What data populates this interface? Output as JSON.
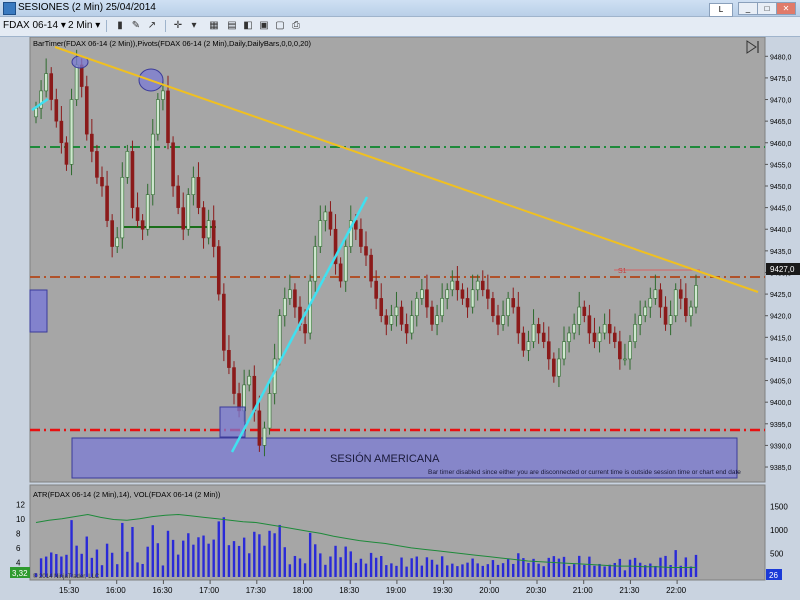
{
  "window": {
    "title": "SESIONES (2 Min)  25/04/2014",
    "layout_button": "L",
    "minimize": "_",
    "maximize": "□",
    "close": "✕"
  },
  "toolbar": {
    "instrument": "FDAX 06-14",
    "interval": "2 Min",
    "dropdown": "▾",
    "icons": [
      "bar-chart-icon",
      "pencil-icon",
      "draw-tool-icon",
      "crosshair-icon",
      "grid-icon",
      "properties-icon",
      "strategies-icon",
      "templates-icon",
      "image-icon",
      "print-icon"
    ]
  },
  "price_panel": {
    "indicator_label": "BarTimer(FDAX 06-14 (2 Min)),Pivots(FDAX 06-14 (2 Min),Daily,DailyBars,0,0,0,20)",
    "current_price": "9427,0",
    "pivot_label": "S1",
    "session_label": "SESIÓN AMERICANA",
    "bar_timer_notice": "Bar timer disabled since either you are disconnected or current time is outside session time or chart end date",
    "price_ticks": [
      "9480,0",
      "9475,0",
      "9470,0",
      "9465,0",
      "9460,0",
      "9455,0",
      "9450,0",
      "9445,0",
      "9440,0",
      "9435,0",
      "9430,0",
      "9425,0",
      "9420,0",
      "9415,0",
      "9410,0",
      "9405,0",
      "9400,0",
      "9395,0",
      "9390,0",
      "9385,0"
    ],
    "colors": {
      "background": "#a6a6a6",
      "up_candle": "#2e6b2e",
      "down_candle": "#8b1a1a",
      "trendline": "#f0c020",
      "cyan_line": "#40e0f0",
      "green_line": "#1a6e1a",
      "green_dashdot": "#1e8a3a",
      "red_dashdot": "#e81010",
      "s1_line": "#b0522a",
      "session_box": "#7b7bd4"
    }
  },
  "indicator_panel": {
    "label": "ATR(FDAX 06-14 (2 Min),14), VOL(FDAX 06-14 (2 Min))",
    "left_ticks": [
      "12",
      "10",
      "8",
      "6",
      "4"
    ],
    "right_ticks": [
      "1500",
      "1000",
      "500"
    ],
    "atr_value": "3,32",
    "vol_value": "26",
    "copyright": "© 2014 NinjaTrader, LLC"
  },
  "time_axis": [
    "15:30",
    "16:00",
    "16:30",
    "17:00",
    "17:30",
    "18:00",
    "18:30",
    "19:00",
    "19:30",
    "20:00",
    "20:30",
    "21:00",
    "21:30",
    "22:00"
  ],
  "chart_data": {
    "type": "candlestick",
    "instrument": "FDAX 06-14",
    "interval": "2 Min",
    "date": "25/04/2014",
    "ylim": [
      9382,
      9484
    ],
    "close_series": [
      9468,
      9472,
      9476,
      9470,
      9465,
      9460,
      9455,
      9470,
      9478,
      9473,
      9462,
      9458,
      9452,
      9450,
      9442,
      9436,
      9438,
      9452,
      9458,
      9445,
      9442,
      9440,
      9448,
      9462,
      9470,
      9472,
      9460,
      9450,
      9445,
      9440,
      9448,
      9452,
      9445,
      9438,
      9442,
      9436,
      9425,
      9412,
      9408,
      9402,
      9398,
      9404,
      9406,
      9398,
      9390,
      9394,
      9402,
      9410,
      9420,
      9424,
      9426,
      9422,
      9418,
      9416,
      9428,
      9436,
      9442,
      9444,
      9440,
      9432,
      9428,
      9436,
      9442,
      9440,
      9436,
      9434,
      9428,
      9424,
      9420,
      9418,
      9420,
      9422,
      9418,
      9416,
      9420,
      9424,
      9426,
      9422,
      9418,
      9420,
      9424,
      9426,
      9428,
      9426,
      9424,
      9422,
      9426,
      9428,
      9426,
      9424,
      9420,
      9418,
      9420,
      9424,
      9422,
      9416,
      9412,
      9414,
      9418,
      9416,
      9414,
      9410,
      9406,
      9410,
      9414,
      9416,
      9418,
      9422,
      9420,
      9416,
      9414,
      9416,
      9418,
      9416,
      9414,
      9410,
      9410,
      9414,
      9418,
      9420,
      9422,
      9424,
      9426,
      9422,
      9418,
      9420,
      9426,
      9424,
      9420,
      9422,
      9427
    ],
    "atr_series": [
      9.5,
      9.8,
      10,
      10.3,
      10.6,
      10.2,
      9.9,
      9.8,
      10,
      10.3,
      10.5,
      10.6,
      10.4,
      10.2,
      10,
      9.8,
      9.6,
      9.5,
      9.2,
      8.9,
      8.6,
      8.3,
      8,
      7.6,
      7.3,
      7,
      6.8,
      6.6,
      6.3,
      6,
      5.8,
      5.6,
      5.4,
      5.2,
      5,
      4.8,
      4.6,
      4.4,
      4.2,
      4.1,
      4,
      3.9,
      3.8,
      3.7,
      3.6,
      3.5,
      3.5,
      3.4,
      3.4,
      3.3,
      3.3,
      3.32
    ],
    "volume_max": 1700
  }
}
